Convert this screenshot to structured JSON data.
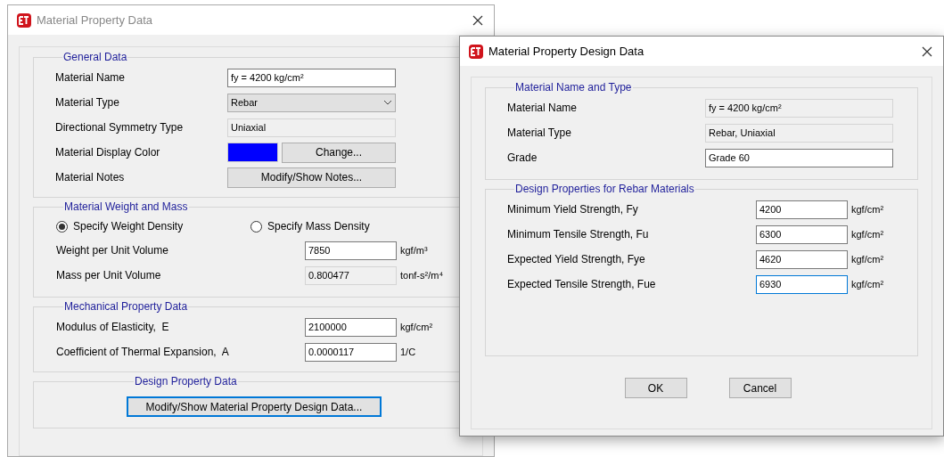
{
  "property_dialog": {
    "title": "Material Property Data",
    "general_data": {
      "legend": "General Data",
      "rows": [
        {
          "kind": "text",
          "label": "Material Name",
          "value": "fy = 4200 kg/cm²"
        },
        {
          "kind": "dropdown",
          "label": "Material Type",
          "value": "Rebar"
        },
        {
          "kind": "readonly",
          "label": "Directional Symmetry Type",
          "value": "Uniaxial"
        },
        {
          "kind": "color",
          "label": "Material Display Color",
          "color": "#0000ff",
          "button": "Change..."
        },
        {
          "kind": "button",
          "label": "Material Notes",
          "button": "Modify/Show Notes..."
        }
      ]
    },
    "weight_and_mass": {
      "legend": "Material Weight and Mass",
      "options": [
        {
          "label": "Specify Weight Density",
          "selected": true
        },
        {
          "label": "Specify Mass Density",
          "selected": false
        }
      ],
      "rows": [
        {
          "kind": "text",
          "label": "Weight per Unit Volume",
          "value": "7850",
          "unit": "kgf/m³"
        },
        {
          "kind": "readonly",
          "label": "Mass per Unit Volume",
          "value": "0.800477",
          "unit": "tonf-s²/m⁴"
        }
      ]
    },
    "mechanical": {
      "legend": "Mechanical Property Data",
      "rows": [
        {
          "label": "Modulus of Elasticity,  E",
          "value": "2100000",
          "unit": "kgf/cm²"
        },
        {
          "label": "Coefficient of Thermal Expansion,  A",
          "value": "0.0000117",
          "unit": "1/C"
        }
      ]
    },
    "design": {
      "legend": "Design Property Data",
      "button": {
        "label": "Modify/Show Material Property Design Data...",
        "focused": true
      }
    }
  },
  "design_dialog": {
    "title": "Material Property Design Data",
    "name_and_type": {
      "legend": "Material Name and Type",
      "rows": [
        {
          "kind": "readonly",
          "label": "Material Name",
          "value": "fy = 4200 kg/cm²"
        },
        {
          "kind": "readonly",
          "label": "Material Type",
          "value": "Rebar, Uniaxial"
        },
        {
          "kind": "text",
          "label": "Grade",
          "value": "Grade 60"
        }
      ]
    },
    "rebar_properties": {
      "legend": "Design Properties for Rebar Materials",
      "rows": [
        {
          "label": "Minimum Yield Strength, Fy",
          "value": "4200",
          "unit": "kgf/cm²",
          "focused": false
        },
        {
          "label": "Minimum Tensile Strength, Fu",
          "value": "6300",
          "unit": "kgf/cm²",
          "focused": false
        },
        {
          "label": "Expected Yield Strength, Fye",
          "value": "4620",
          "unit": "kgf/cm²",
          "focused": false
        },
        {
          "label": "Expected Tensile Strength, Fue",
          "value": "6930",
          "unit": "kgf/cm²",
          "focused": true
        }
      ]
    },
    "buttons": [
      "OK",
      "Cancel"
    ]
  }
}
